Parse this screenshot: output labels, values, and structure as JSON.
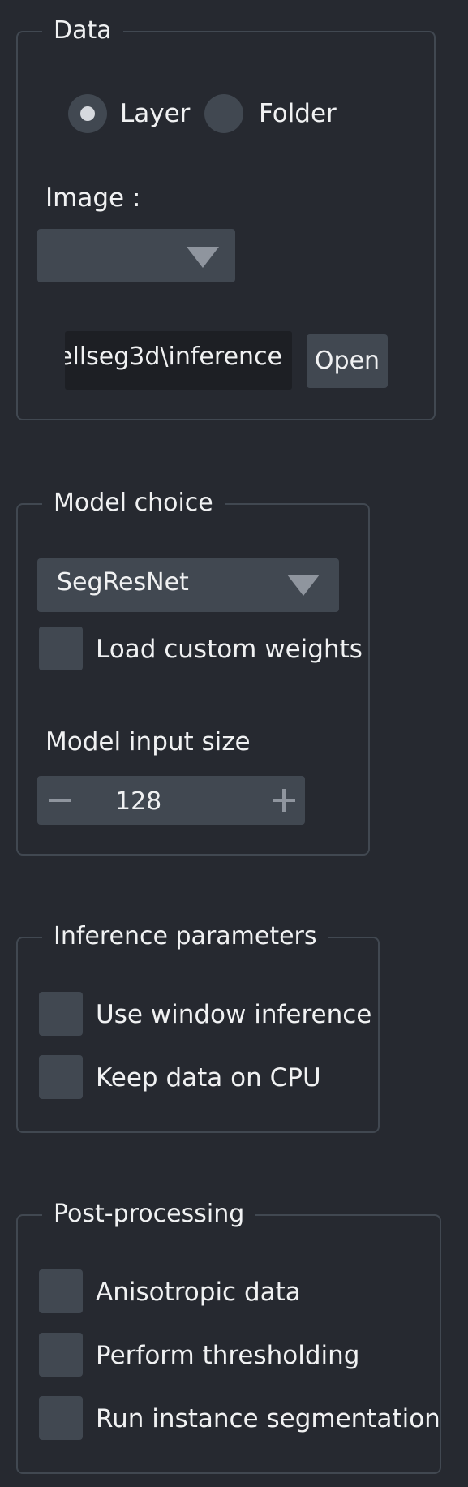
{
  "data_group": {
    "title": "Data",
    "radio_layer": "Layer",
    "radio_folder": "Folder",
    "image_label": "Image :",
    "image_combo_value": "",
    "path_value": "ellseg3d\\inference",
    "open_button": "Open"
  },
  "model_group": {
    "title": "Model choice",
    "model_combo_value": "SegResNet",
    "load_weights_label": "Load custom weights",
    "input_size_label": "Model input size",
    "input_size_value": "128"
  },
  "inference_group": {
    "title": "Inference parameters",
    "window_inference_label": "Use window inference",
    "keep_cpu_label": "Keep data on CPU"
  },
  "postprocessing_group": {
    "title": "Post-processing",
    "anisotropic_label": "Anisotropic data",
    "thresholding_label": "Perform thresholding",
    "instance_seg_label": "Run instance segmentation"
  },
  "colors": {
    "background": "#262930",
    "widget": "#414851",
    "border": "#414851",
    "text": "#f0f1f2"
  }
}
